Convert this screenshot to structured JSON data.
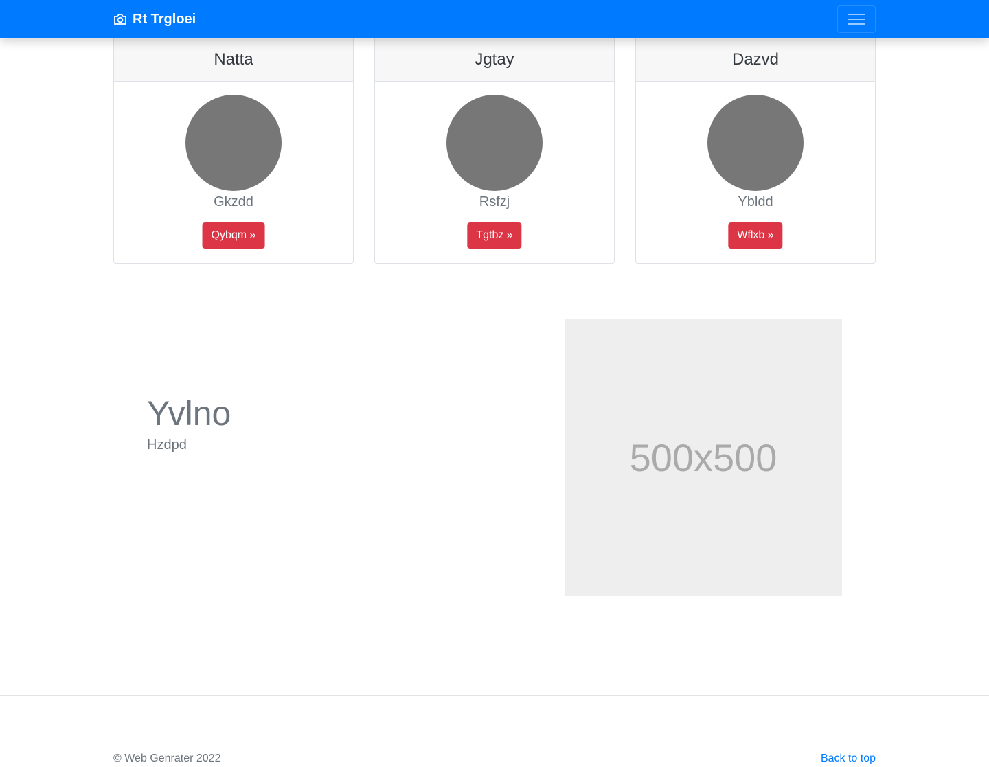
{
  "navbar": {
    "brand_icon": "camera-icon",
    "brand_label": "Rt Trgloei",
    "toggler_icon": "hamburger-menu-icon",
    "background_color": "#007bff"
  },
  "cards": [
    {
      "title": "Natta",
      "name": "Gkzdd",
      "button_label": "Qybqm »"
    },
    {
      "title": "Jgtay",
      "name": "Rsfzj",
      "button_label": "Tgtbz »"
    },
    {
      "title": "Dazvd",
      "name": "Ybldd",
      "button_label": "Wflxb »"
    }
  ],
  "feature": {
    "heading": "Yvlno",
    "subheading": "Hzdpd",
    "image_label": "500x500"
  },
  "footer": {
    "copyright": "© Web Genrater 2022",
    "back_to_top": "Back to top"
  },
  "colors": {
    "primary": "#007bff",
    "danger": "#dc3545",
    "muted": "#6c757d"
  }
}
